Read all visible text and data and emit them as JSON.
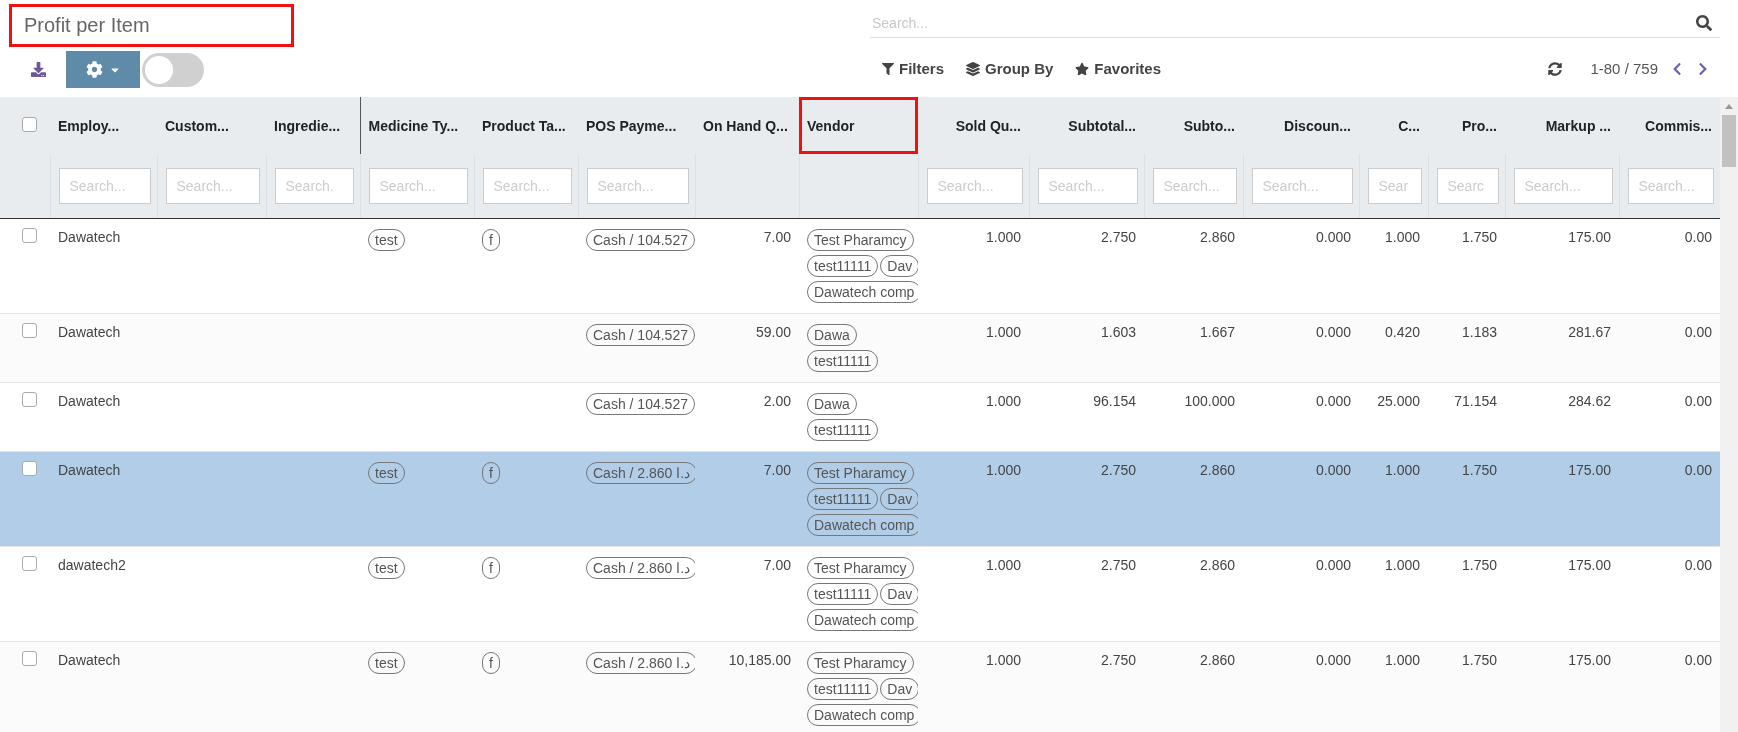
{
  "title": {
    "text": "Profit per Item",
    "highlighted": true
  },
  "toolbar": {
    "toggle_on": false
  },
  "search": {
    "placeholder": "Search..."
  },
  "filters": [
    "Filters",
    "Group By",
    "Favorites"
  ],
  "pager": "1-80 / 759",
  "header_checkbox": {
    "checked": false
  },
  "columns": [
    {
      "label": "Employ...",
      "numeric": false,
      "placeholder": "Search...",
      "divider": false
    },
    {
      "label": "Custom...",
      "numeric": false,
      "placeholder": "Search...",
      "divider": false
    },
    {
      "label": "Ingredie...",
      "numeric": false,
      "placeholder": "Search.",
      "divider": false
    },
    {
      "label": "Medicine Ty...",
      "numeric": false,
      "placeholder": "Search...",
      "divider": true
    },
    {
      "label": "Product Ta...",
      "numeric": false,
      "placeholder": "Search...",
      "divider": false
    },
    {
      "label": "POS Payme...",
      "numeric": false,
      "placeholder": "Search...",
      "divider": false
    },
    {
      "label": "On Hand Q...",
      "numeric": false,
      "divider": false
    },
    {
      "label": "Vendor",
      "numeric": false,
      "highlighted": true,
      "divider": false
    },
    {
      "label": "Sold Qu...",
      "numeric": true,
      "placeholder": "Search...",
      "divider": false
    },
    {
      "label": "Subtotal...",
      "numeric": true,
      "placeholder": "Search...",
      "divider": false
    },
    {
      "label": "Subto...",
      "numeric": true,
      "placeholder": "Search...",
      "divider": false
    },
    {
      "label": "Discoun...",
      "numeric": true,
      "placeholder": "Search...",
      "divider": false
    },
    {
      "label": "C...",
      "numeric": true,
      "placeholder": "Sear",
      "divider": false
    },
    {
      "label": "Pro...",
      "numeric": true,
      "placeholder": "Searc",
      "divider": false
    },
    {
      "label": "Markup ...",
      "numeric": true,
      "placeholder": "Search...",
      "divider": false
    },
    {
      "label": "Commis...",
      "numeric": true,
      "placeholder": "Search...",
      "divider": false
    }
  ],
  "rows": [
    {
      "selected": false,
      "checked": false,
      "cells": [
        {
          "kind": "text",
          "value": "Dawatech"
        },
        {
          "kind": "empty"
        },
        {
          "kind": "empty"
        },
        {
          "kind": "tags",
          "tags": [
            "test"
          ]
        },
        {
          "kind": "tags",
          "tags": [
            "f"
          ]
        },
        {
          "kind": "tags",
          "tags": [
            "Cash / 104.527"
          ]
        },
        {
          "kind": "number",
          "value": "7.00"
        },
        {
          "kind": "tags",
          "tags": [
            "Test Pharamcy",
            "test11111",
            "Dav",
            "Dawatech comp"
          ]
        },
        {
          "kind": "number",
          "value": "1.000"
        },
        {
          "kind": "number",
          "value": "2.750"
        },
        {
          "kind": "number",
          "value": "2.860"
        },
        {
          "kind": "number",
          "value": "0.000"
        },
        {
          "kind": "number",
          "value": "1.000"
        },
        {
          "kind": "number",
          "value": "1.750"
        },
        {
          "kind": "number",
          "value": "175.00"
        },
        {
          "kind": "number",
          "value": "0.00"
        }
      ]
    },
    {
      "selected": false,
      "checked": false,
      "cells": [
        {
          "kind": "text",
          "value": "Dawatech"
        },
        {
          "kind": "empty"
        },
        {
          "kind": "empty"
        },
        {
          "kind": "empty"
        },
        {
          "kind": "empty"
        },
        {
          "kind": "tags",
          "tags": [
            "Cash / 104.527"
          ]
        },
        {
          "kind": "number",
          "value": "59.00"
        },
        {
          "kind": "tags",
          "tags": [
            "Dawa",
            "test11111"
          ]
        },
        {
          "kind": "number",
          "value": "1.000"
        },
        {
          "kind": "number",
          "value": "1.603"
        },
        {
          "kind": "number",
          "value": "1.667"
        },
        {
          "kind": "number",
          "value": "0.000"
        },
        {
          "kind": "number",
          "value": "0.420"
        },
        {
          "kind": "number",
          "value": "1.183"
        },
        {
          "kind": "number",
          "value": "281.67"
        },
        {
          "kind": "number",
          "value": "0.00"
        }
      ]
    },
    {
      "selected": false,
      "checked": false,
      "cells": [
        {
          "kind": "text",
          "value": "Dawatech"
        },
        {
          "kind": "empty"
        },
        {
          "kind": "empty"
        },
        {
          "kind": "empty"
        },
        {
          "kind": "empty"
        },
        {
          "kind": "tags",
          "tags": [
            "Cash / 104.527"
          ]
        },
        {
          "kind": "number",
          "value": "2.00"
        },
        {
          "kind": "tags",
          "tags": [
            "Dawa",
            "test11111"
          ]
        },
        {
          "kind": "number",
          "value": "1.000"
        },
        {
          "kind": "number",
          "value": "96.154"
        },
        {
          "kind": "number",
          "value": "100.000"
        },
        {
          "kind": "number",
          "value": "0.000"
        },
        {
          "kind": "number",
          "value": "25.000"
        },
        {
          "kind": "number",
          "value": "71.154"
        },
        {
          "kind": "number",
          "value": "284.62"
        },
        {
          "kind": "number",
          "value": "0.00"
        }
      ]
    },
    {
      "selected": true,
      "checked": false,
      "cells": [
        {
          "kind": "text",
          "value": "Dawatech"
        },
        {
          "kind": "empty"
        },
        {
          "kind": "empty"
        },
        {
          "kind": "tags",
          "tags": [
            "test"
          ]
        },
        {
          "kind": "tags",
          "tags": [
            "f"
          ]
        },
        {
          "kind": "tags",
          "tags": [
            "Cash / 2.860 د.ا"
          ]
        },
        {
          "kind": "number",
          "value": "7.00"
        },
        {
          "kind": "tags",
          "tags": [
            "Test Pharamcy",
            "test11111",
            "Dav",
            "Dawatech comp"
          ]
        },
        {
          "kind": "number",
          "value": "1.000"
        },
        {
          "kind": "number",
          "value": "2.750"
        },
        {
          "kind": "number",
          "value": "2.860"
        },
        {
          "kind": "number",
          "value": "0.000"
        },
        {
          "kind": "number",
          "value": "1.000"
        },
        {
          "kind": "number",
          "value": "1.750"
        },
        {
          "kind": "number",
          "value": "175.00"
        },
        {
          "kind": "number",
          "value": "0.00"
        }
      ]
    },
    {
      "selected": false,
      "checked": false,
      "cells": [
        {
          "kind": "text",
          "value": "dawatech2"
        },
        {
          "kind": "empty"
        },
        {
          "kind": "empty"
        },
        {
          "kind": "tags",
          "tags": [
            "test"
          ]
        },
        {
          "kind": "tags",
          "tags": [
            "f"
          ]
        },
        {
          "kind": "tags",
          "tags": [
            "Cash / 2.860 د.ا"
          ]
        },
        {
          "kind": "number",
          "value": "7.00"
        },
        {
          "kind": "tags",
          "tags": [
            "Test Pharamcy",
            "test11111",
            "Dav",
            "Dawatech comp"
          ]
        },
        {
          "kind": "number",
          "value": "1.000"
        },
        {
          "kind": "number",
          "value": "2.750"
        },
        {
          "kind": "number",
          "value": "2.860"
        },
        {
          "kind": "number",
          "value": "0.000"
        },
        {
          "kind": "number",
          "value": "1.000"
        },
        {
          "kind": "number",
          "value": "1.750"
        },
        {
          "kind": "number",
          "value": "175.00"
        },
        {
          "kind": "number",
          "value": "0.00"
        }
      ]
    },
    {
      "selected": false,
      "checked": false,
      "cells": [
        {
          "kind": "text",
          "value": "Dawatech"
        },
        {
          "kind": "empty"
        },
        {
          "kind": "empty"
        },
        {
          "kind": "tags",
          "tags": [
            "test"
          ]
        },
        {
          "kind": "tags",
          "tags": [
            "f"
          ]
        },
        {
          "kind": "tags",
          "tags": [
            "Cash / 2.860 د.ا"
          ]
        },
        {
          "kind": "number",
          "value": "10,185.00"
        },
        {
          "kind": "tags",
          "tags": [
            "Test Pharamcy",
            "test11111",
            "Dav",
            "Dawatech comp"
          ]
        },
        {
          "kind": "number",
          "value": "1.000"
        },
        {
          "kind": "number",
          "value": "2.750"
        },
        {
          "kind": "number",
          "value": "2.860"
        },
        {
          "kind": "number",
          "value": "0.000"
        },
        {
          "kind": "number",
          "value": "1.000"
        },
        {
          "kind": "number",
          "value": "1.750"
        },
        {
          "kind": "number",
          "value": "175.00"
        },
        {
          "kind": "number",
          "value": "0.00"
        }
      ]
    }
  ]
}
